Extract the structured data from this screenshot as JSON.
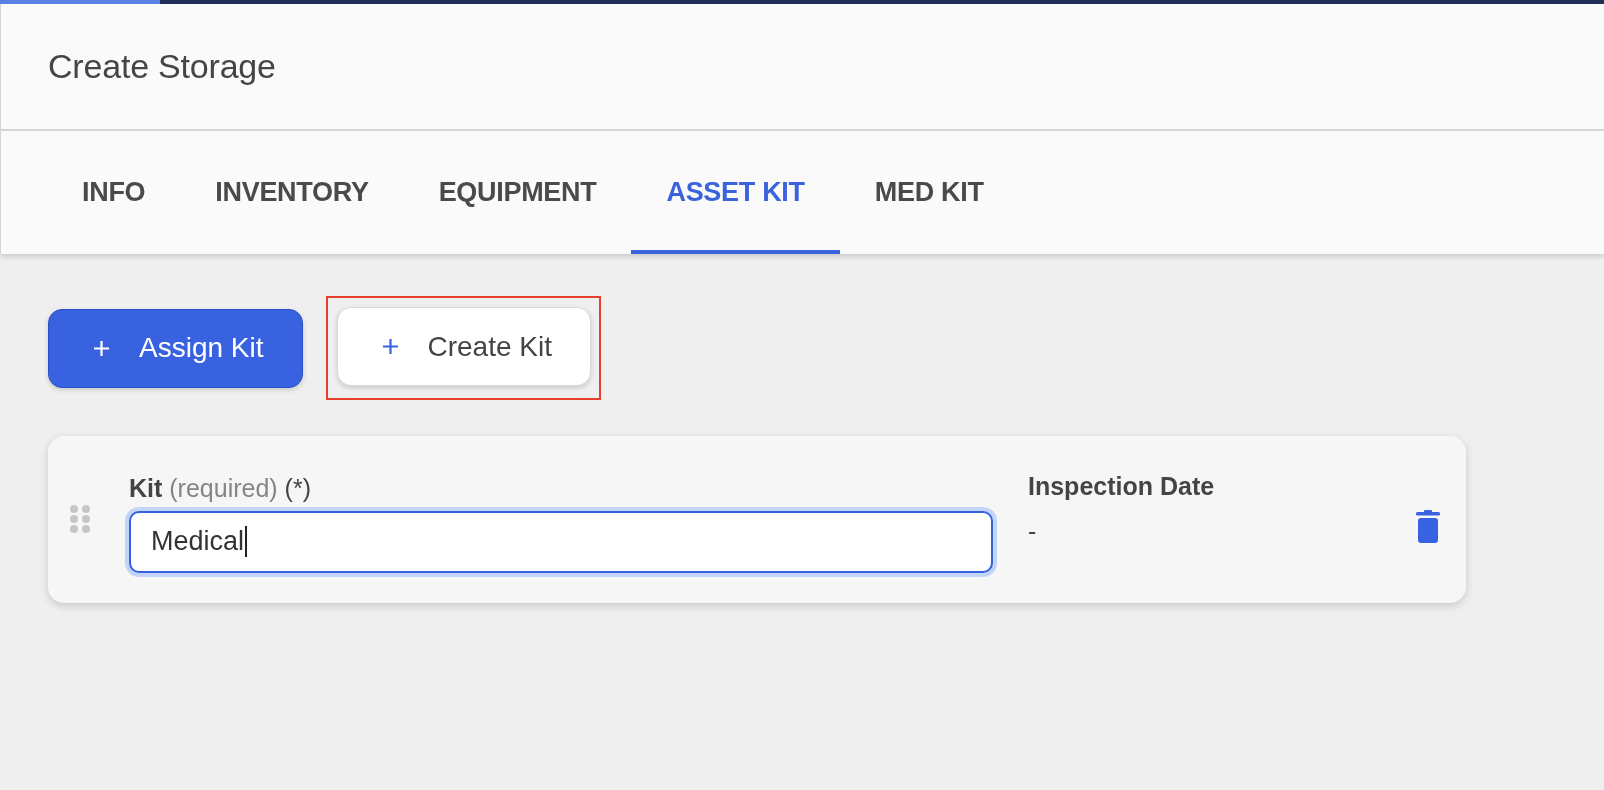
{
  "progress_bar": {
    "level": 0.1
  },
  "page": {
    "title": "Create Storage"
  },
  "tabs": [
    {
      "label": "INFO",
      "selected": false
    },
    {
      "label": "INVENTORY",
      "selected": false
    },
    {
      "label": "EQUIPMENT",
      "selected": false
    },
    {
      "label": "ASSET KIT",
      "selected": true
    },
    {
      "label": "MED KIT",
      "selected": false
    }
  ],
  "actions": [
    {
      "label": "Assign Kit",
      "kind": "primary",
      "highlighted": false
    },
    {
      "label": "Create Kit",
      "kind": "secondary",
      "highlighted": true
    }
  ],
  "kits": [
    {
      "kit_field": {
        "label": "Kit",
        "hint": "(required)",
        "required_mark": "(*)",
        "value": "Medical",
        "focused": true
      },
      "inspection_date": {
        "label": "Inspection Date",
        "value": "-"
      }
    }
  ]
}
